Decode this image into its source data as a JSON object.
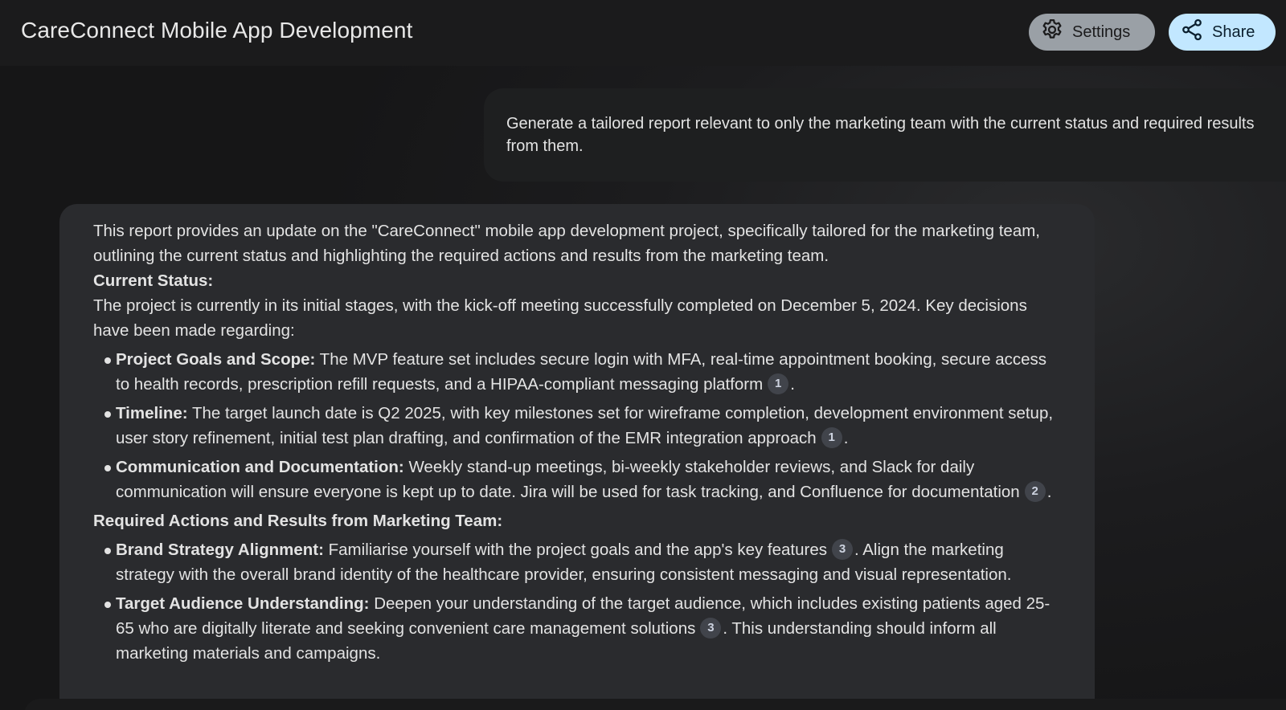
{
  "header": {
    "title": "CareConnect Mobile App Development",
    "settings_label": "Settings",
    "share_label": "Share",
    "settings_icon": "gear-icon",
    "share_icon": "share-icon"
  },
  "user_message": {
    "text": "Generate a tailored report relevant to only the marketing team with the current status and required results from them."
  },
  "response": {
    "intro": "This report provides an update on the \"CareConnect\" mobile app development project, specifically tailored for the marketing team, outlining the current status and highlighting the required actions and results from the marketing team.",
    "current_status": {
      "heading": "Current Status:",
      "text": "The project is currently in its initial stages, with the kick-off meeting successfully completed on December 5, 2024. Key decisions have been made regarding:",
      "items": [
        {
          "title": "Project Goals and Scope:",
          "text": " The MVP feature set includes secure login with MFA, real-time appointment booking, secure access to health records, prescription refill requests, and a HIPAA-compliant messaging platform",
          "cite": "1",
          "after": "."
        },
        {
          "title": "Timeline:",
          "text": " The target launch date is Q2 2025, with key milestones set for wireframe completion, development environment setup, user story refinement, initial test plan drafting, and confirmation of the EMR integration approach",
          "cite": "1",
          "after": "."
        },
        {
          "title": "Communication and Documentation:",
          "text": " Weekly stand-up meetings, bi-weekly stakeholder reviews, and Slack for daily communication will ensure everyone is kept up to date. Jira will be used for task tracking, and Confluence for documentation",
          "cite": "2",
          "after": "."
        }
      ]
    },
    "required_actions": {
      "heading": "Required Actions and Results from Marketing Team:",
      "items": [
        {
          "title": "Brand Strategy Alignment:",
          "text": " Familiarise yourself with the project goals and the app's key features",
          "cite": "3",
          "after": ". Align the marketing strategy with the overall brand identity of the healthcare provider, ensuring consistent messaging and visual representation."
        },
        {
          "title": "Target Audience Understanding:",
          "text": " Deepen your understanding of the target audience, which includes existing patients aged 25-65 who are digitally literate and seeking convenient care management solutions",
          "cite": "3",
          "after": ". This understanding should inform all marketing materials and campaigns."
        }
      ]
    }
  }
}
